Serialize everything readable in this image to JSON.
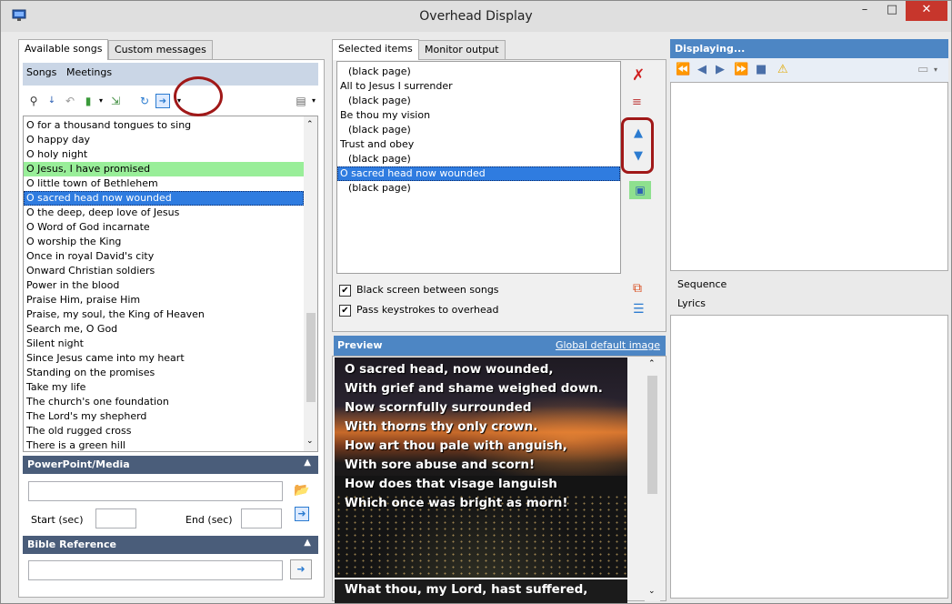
{
  "window": {
    "title": "Overhead Display",
    "minimize": "–",
    "maximize": "□",
    "close": "✕"
  },
  "left": {
    "tabs": [
      "Available songs",
      "Custom messages"
    ],
    "subtabs": [
      "Songs",
      "Meetings"
    ],
    "songs": [
      "O for a thousand tongues to sing",
      "O happy day",
      "O holy night",
      "O Jesus, I have promised",
      "O little town of Bethlehem",
      "O sacred head now wounded",
      "O the deep, deep love of Jesus",
      "O Word of God incarnate",
      "O worship the King",
      "Once in royal David's city",
      "Onward Christian soldiers",
      "Power in the blood",
      "Praise Him, praise Him",
      "Praise, my soul, the King of Heaven",
      "Search me, O God",
      "Silent night",
      "Since Jesus came into my heart",
      "Standing on the promises",
      "Take my life",
      "The church's one foundation",
      "The Lord's my shepherd",
      "The old rugged cross",
      "There is a green hill"
    ],
    "highlighted_song": "O Jesus, I have promised",
    "selected_song": "O sacred head now wounded",
    "powerpoint": {
      "header": "PowerPoint/Media",
      "start_label": "Start (sec)",
      "end_label": "End (sec)",
      "file_value": "",
      "start_value": "",
      "end_value": ""
    },
    "bible": {
      "header": "Bible Reference",
      "value": ""
    }
  },
  "middle": {
    "tabs": [
      "Selected items",
      "Monitor output"
    ],
    "items": [
      {
        "text": "(black page)",
        "indent": true
      },
      {
        "text": "All to Jesus I surrender",
        "indent": false
      },
      {
        "text": "(black page)",
        "indent": true
      },
      {
        "text": "Be thou my vision",
        "indent": false
      },
      {
        "text": "(black page)",
        "indent": true
      },
      {
        "text": "Trust and obey",
        "indent": false
      },
      {
        "text": "(black page)",
        "indent": true
      },
      {
        "text": "O sacred head now wounded",
        "indent": false,
        "selected": true
      },
      {
        "text": "(black page)",
        "indent": true
      }
    ],
    "checkboxes": [
      {
        "label": "Black screen between songs",
        "checked": true
      },
      {
        "label": "Pass keystrokes to overhead",
        "checked": true
      }
    ],
    "preview": {
      "header": "Preview",
      "link": "Global default image",
      "lines": [
        "O sacred head, now wounded,",
        "With grief and shame weighed down.",
        "Now scornfully surrounded",
        "With thorns thy only crown.",
        "How art thou pale with anguish,",
        "With sore abuse and scorn!",
        "How does that visage languish",
        "Which once was bright as morn!"
      ],
      "next_line": "What thou, my Lord, hast suffered,"
    }
  },
  "right": {
    "header": "Displaying...",
    "sequence_label": "Sequence",
    "lyrics_label": "Lyrics"
  },
  "colors": {
    "accent": "#4d86c4",
    "selection": "#2f7ce0",
    "highlight": "#99ee99",
    "section_header": "#4a5d7a",
    "annotation": "#a01818"
  }
}
